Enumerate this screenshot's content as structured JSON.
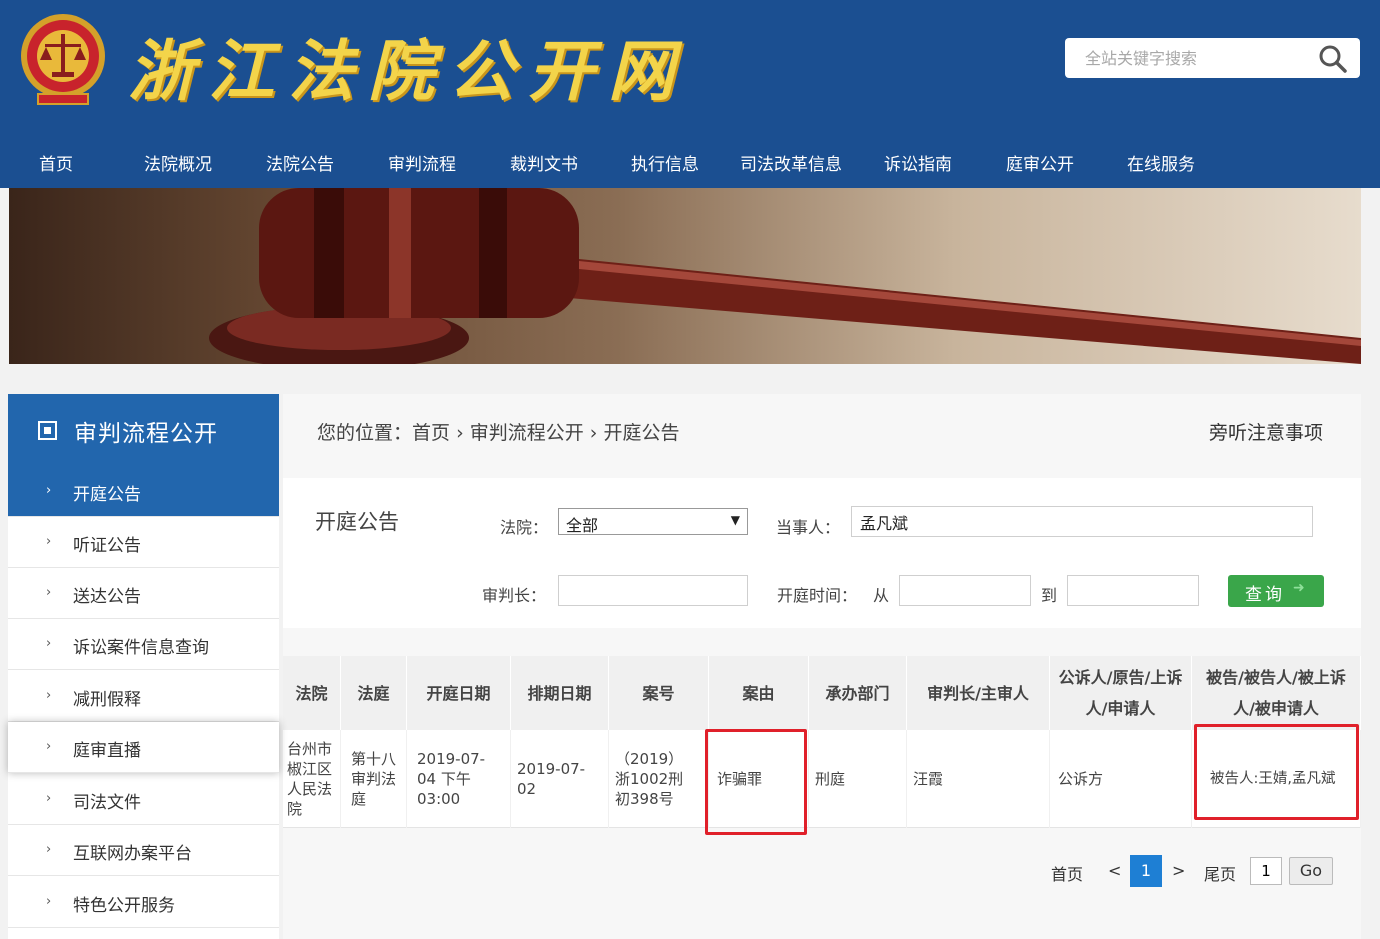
{
  "header": {
    "site_title": "浙江法院公开网",
    "search_placeholder": "全站关键字搜索",
    "nav": [
      "首页",
      "法院概况",
      "法院公告",
      "审判流程",
      "裁判文书",
      "执行信息",
      "司法改革信息",
      "诉讼指南",
      "庭审公开",
      "在线服务"
    ]
  },
  "sidebar": {
    "title": "审判流程公开",
    "items": [
      "开庭公告",
      "听证公告",
      "送达公告",
      "诉讼案件信息查询",
      "减刑假释",
      "庭审直播",
      "司法文件",
      "互联网办案平台",
      "特色公开服务"
    ],
    "active_index": 0
  },
  "breadcrumb": {
    "prefix": "您的位置：",
    "items": [
      "首页",
      "审判流程公开",
      "开庭公告"
    ],
    "sep": "›"
  },
  "notice_link": "旁听注意事项",
  "form": {
    "title": "开庭公告",
    "court_label": "法院：",
    "court_value": "全部",
    "party_label": "当事人：",
    "party_value": "孟凡斌",
    "judge_label": "审判长：",
    "judge_value": "",
    "time_label": "开庭时间：",
    "from_label": "从",
    "to_label": "到",
    "time_from": "",
    "time_to": "",
    "query_label": "查询",
    "query_arrow": "➜"
  },
  "table": {
    "headers": [
      "法院",
      "法庭",
      "开庭日期",
      "排期日期",
      "案号",
      "案由",
      "承办部门",
      "审判长/主审人",
      "公诉人/原告/上诉人/申请人",
      "被告/被告人/被上诉人/被申请人"
    ],
    "rows": [
      {
        "court": "台州市椒江区人民法院",
        "room": "第十八审判法庭",
        "hearing_date": "2019-07-04 下午03:00",
        "schedule_date": "2019-07-02",
        "case_no": "（2019）浙1002刑初398号",
        "cause": "诈骗罪",
        "department": "刑庭",
        "judge": "汪霞",
        "plaintiff": "公诉方",
        "defendant": "被告人:王婧,孟凡斌"
      }
    ]
  },
  "pager": {
    "first": "首页",
    "prev": "<",
    "current": "1",
    "next": ">",
    "last": "尾页",
    "page_input": "1",
    "go": "Go"
  },
  "colors": {
    "header_blue": "#1b4f91",
    "active_blue": "#2266ad",
    "title_gold": "#f3d44a",
    "query_green": "#3aa64a",
    "highlight_red": "#e0202a"
  }
}
